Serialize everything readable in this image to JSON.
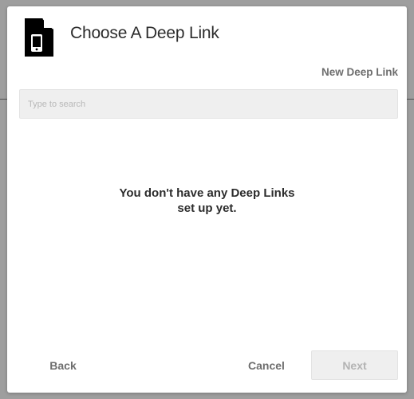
{
  "dialog": {
    "title": "Choose A Deep Link",
    "icon": "mobile-document-icon",
    "new_link_label": "New Deep Link",
    "search": {
      "placeholder": "Type to search",
      "value": ""
    },
    "empty_message": {
      "line1": "You don't have any Deep Links",
      "line2": "set up yet."
    },
    "footer": {
      "back_label": "Back",
      "cancel_label": "Cancel",
      "next_label": "Next",
      "next_disabled": true
    }
  },
  "colors": {
    "backdrop": "#9e9e9e",
    "dialog_bg": "#ffffff",
    "text_primary": "#2c2c2c",
    "text_secondary": "#6e6e6e",
    "field_bg": "#efefef",
    "disabled_text": "#b3b3b3"
  }
}
